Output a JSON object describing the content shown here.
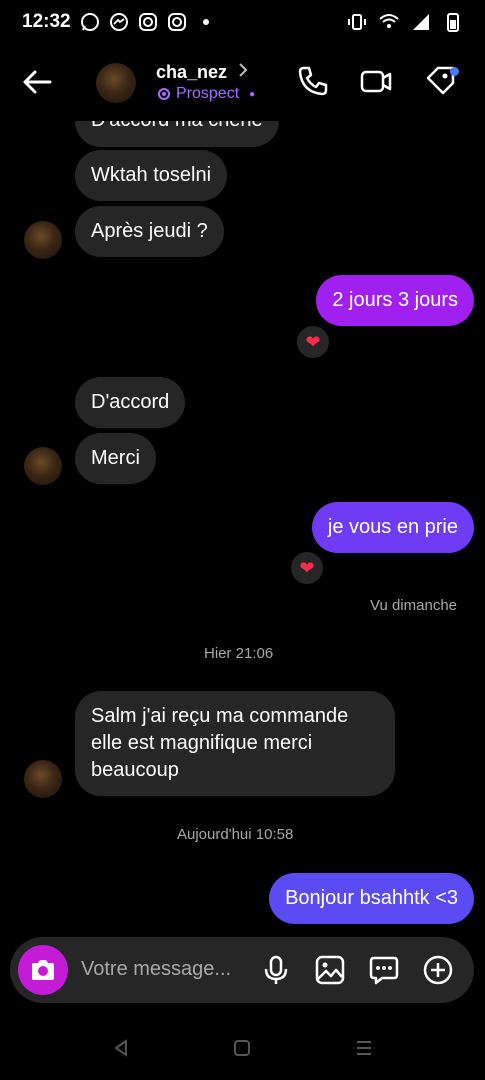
{
  "status": {
    "time": "12:32"
  },
  "header": {
    "username": "cha_nez",
    "label": "Prospect"
  },
  "messages": [
    {
      "side": "in",
      "text": "D'accord ma chérie"
    },
    {
      "side": "in",
      "text": "Wktah toselni"
    },
    {
      "side": "in",
      "text": "Après jeudi ?"
    },
    {
      "side": "out",
      "text": "2 jours 3 jours",
      "reaction": "heart"
    },
    {
      "side": "in",
      "text": "D'accord"
    },
    {
      "side": "in",
      "text": "Merci"
    },
    {
      "side": "out",
      "text": "je vous en prie",
      "reaction": "heart"
    },
    {
      "side": "in",
      "text": "Salm j'ai reçu ma commande elle est magnifique merci beaucoup"
    },
    {
      "side": "out",
      "text": "Bonjour bsahhtk <3"
    }
  ],
  "meta": {
    "seen": "Vu dimanche",
    "time_hier": "Hier 21:06",
    "time_today": "Aujourd'hui 10:58"
  },
  "composer": {
    "placeholder": "Votre message..."
  },
  "colors": {
    "bubble_in": "#262626",
    "bubble_out_1": "#a020f0",
    "bubble_out_2": "#6f3bf5",
    "bubble_out_3": "#5a4bf2",
    "camera": "#c41bd6",
    "prospect": "#a56cff"
  },
  "icons": {
    "back": "arrow-left-icon",
    "call": "phone-icon",
    "video": "video-icon",
    "tag": "tag-icon",
    "camera": "camera-icon",
    "mic": "microphone-icon",
    "gallery": "image-icon",
    "sticker": "chat-bubble-icon",
    "add": "plus-circle-icon"
  }
}
